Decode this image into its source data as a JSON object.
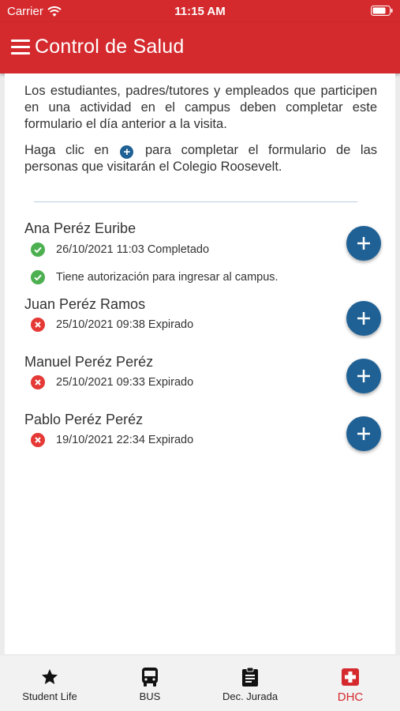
{
  "status_bar": {
    "carrier": "Carrier",
    "time": "11:15 AM"
  },
  "header": {
    "title": "Control de Salud"
  },
  "intro": {
    "paragraph1": "Los estudiantes, padres/tutores y empleados que participen en una actividad en el campus deben completar este formulario el día anterior a la visita.",
    "paragraph2_before": "Haga clic en",
    "paragraph2_after": "para completar el formulario de las personas que visitarán el Colegio Roosevelt."
  },
  "people": [
    {
      "name": "Ana Peréz Euribe",
      "status": "26/10/2021 11:03 Completado",
      "note": "Tiene autorización para ingresar al campus."
    },
    {
      "name": "Juan Peréz Ramos",
      "status": "25/10/2021 09:38 Expirado"
    },
    {
      "name": "Manuel Peréz Peréz",
      "status": "25/10/2021 09:33 Expirado"
    },
    {
      "name": "Pablo Peréz Peréz",
      "status": "19/10/2021 22:34 Expirado"
    }
  ],
  "nav": [
    {
      "label": "Student Life",
      "icon": "star-icon"
    },
    {
      "label": "BUS",
      "icon": "bus-icon"
    },
    {
      "label": "Dec. Jurada",
      "icon": "clipboard-icon"
    },
    {
      "label": "DHC",
      "icon": "medical-cross-icon",
      "active": true
    }
  ],
  "colors": {
    "primary": "#d42a2e",
    "accent": "#1f6195",
    "ok": "#4caf50",
    "error": "#e53935"
  }
}
